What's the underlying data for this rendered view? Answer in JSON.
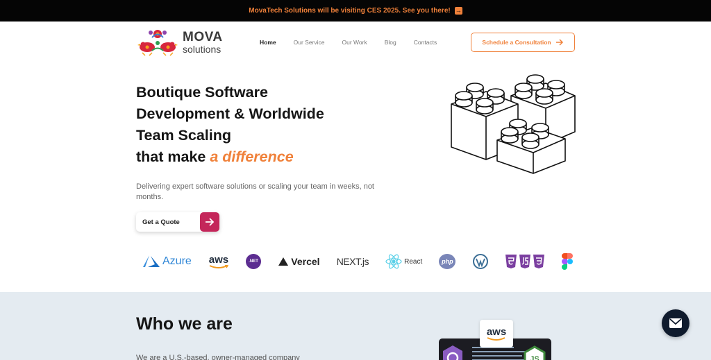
{
  "banner": {
    "text": "MovaTech Solutions will be visiting CES 2025. See you there!",
    "icon": "arrow-right-square-icon",
    "color": "#f0813a"
  },
  "brand": {
    "name": "MOVA",
    "tagline": "solutions"
  },
  "nav": {
    "items": [
      {
        "label": "Home",
        "active": true
      },
      {
        "label": "Our Service",
        "active": false
      },
      {
        "label": "Our Work",
        "active": false
      },
      {
        "label": "Blog",
        "active": false
      },
      {
        "label": "Contacts",
        "active": false
      }
    ],
    "cta_label": "Schedule a Consultation"
  },
  "hero": {
    "title_lines": [
      "Boutique Software",
      "Development & Worldwide",
      "Team Scaling"
    ],
    "title_tail": "that make",
    "title_accent": "a difference",
    "subtitle": "Delivering expert software solutions or scaling your team in weeks, not months.",
    "quote_button": "Get a Quote"
  },
  "tech_logos": [
    {
      "name": "azure",
      "label": "Azure"
    },
    {
      "name": "aws",
      "label": "aws"
    },
    {
      "name": "dotnet",
      "label": ".NET"
    },
    {
      "name": "vercel",
      "label": "Vercel"
    },
    {
      "name": "nextjs",
      "label": "NEXT.js"
    },
    {
      "name": "react",
      "label": "React"
    },
    {
      "name": "php",
      "label": "php"
    },
    {
      "name": "wordpress",
      "label": ""
    },
    {
      "name": "html-js-css",
      "label": ""
    },
    {
      "name": "figma",
      "label": ""
    }
  ],
  "about": {
    "title": "Who we are",
    "text": "We are a U.S.-based, owner-managed company",
    "aws_card_label": "aws"
  },
  "colors": {
    "accent": "#f0813a",
    "primary_button": "#c4265a",
    "banner_bg": "#050505",
    "section_bg": "#e4ebf1",
    "chat_button": "#0f1b2d"
  }
}
